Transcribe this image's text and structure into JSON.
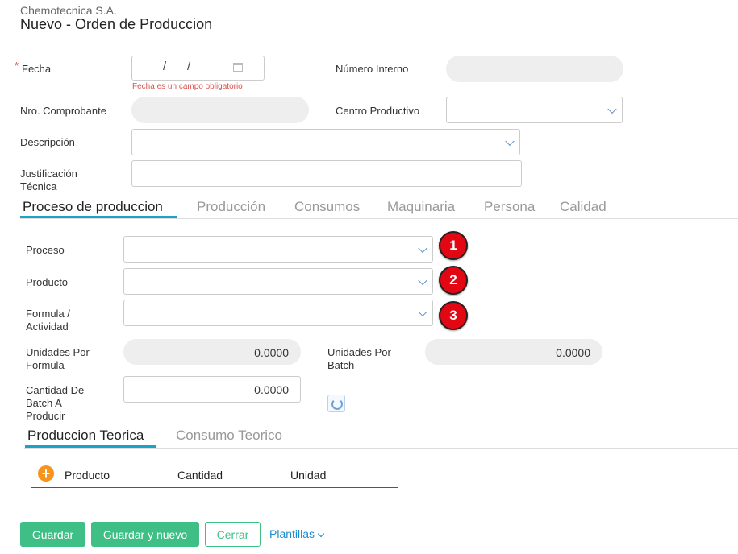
{
  "header": {
    "company": "Chemotecnica S.A.",
    "title": "Nuevo - Orden de Produccion"
  },
  "form": {
    "fecha": {
      "required_mark": "*",
      "label": "Fecha",
      "sep1": "/",
      "sep2": "/",
      "error": "Fecha es un campo obligatorio"
    },
    "numero_interno": {
      "label": "Número Interno",
      "value": ""
    },
    "nro_comprobante": {
      "label": "Nro. Comprobante",
      "value": ""
    },
    "centro_productivo": {
      "label": "Centro Productivo",
      "value": ""
    },
    "descripcion": {
      "label": "Descripción",
      "value": ""
    },
    "justificacion": {
      "label_line1": "Justificación",
      "label_line2": "Técnica",
      "value": ""
    }
  },
  "tabs": [
    {
      "label": "Proceso de produccion",
      "active": true
    },
    {
      "label": "Producción"
    },
    {
      "label": "Consumos"
    },
    {
      "label": "Maquinaria"
    },
    {
      "label": "Persona"
    },
    {
      "label": "Calidad"
    }
  ],
  "proceso": {
    "proceso": {
      "label": "Proceso",
      "value": "",
      "badge": "1"
    },
    "producto": {
      "label": "Producto",
      "value": "",
      "badge": "2"
    },
    "formula": {
      "label_line1": "Formula /",
      "label_line2": "Actividad",
      "value": "",
      "badge": "3"
    },
    "unidades_formula": {
      "label_line1": "Unidades Por",
      "label_line2": "Formula",
      "value": "0.0000"
    },
    "unidades_batch": {
      "label_line1": "Unidades Por",
      "label_line2": "Batch",
      "value": "0.0000"
    },
    "cantidad_batch": {
      "label_line1": "Cantidad De",
      "label_line2": "Batch A",
      "label_line3": "Producir",
      "value": "0.0000"
    }
  },
  "subtabs": [
    {
      "label": "Produccion Teorica",
      "active": true
    },
    {
      "label": "Consumo Teorico"
    }
  ],
  "table": {
    "add_symbol": "+",
    "columns": [
      "Producto",
      "Cantidad",
      "Unidad"
    ]
  },
  "footer": {
    "guardar": "Guardar",
    "guardar_nuevo": "Guardar y nuevo",
    "cerrar": "Cerrar",
    "plantillas": "Plantillas"
  },
  "colors": {
    "accent_tab": "#1aa3c9",
    "primary_button": "#3fbf85",
    "badge": "#e30613",
    "error": "#d9534f",
    "link": "#1a8ccf"
  }
}
